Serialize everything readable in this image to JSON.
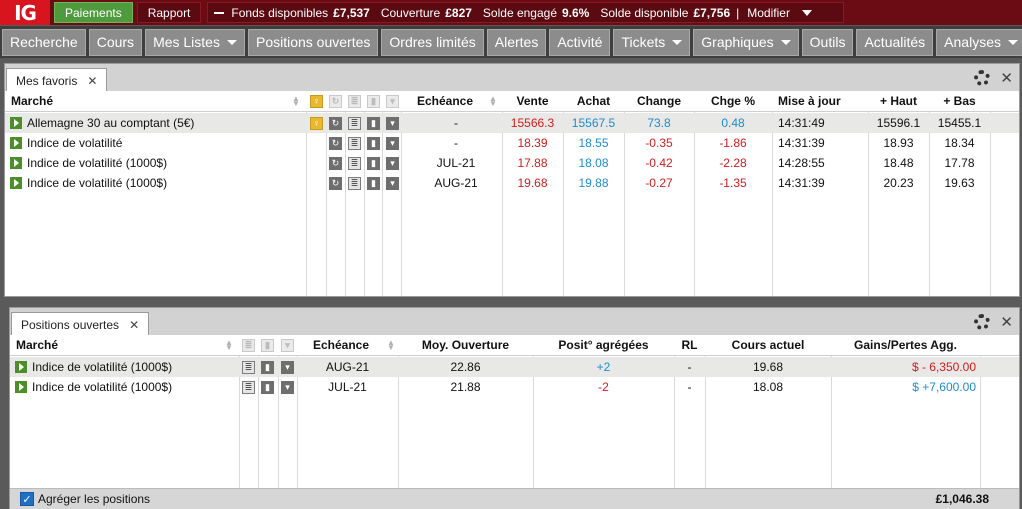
{
  "topbar": {
    "logo": "IG",
    "payments_label": "Paiements",
    "report_label": "Rapport",
    "funds_label": "Fonds disponibles",
    "funds_value": "£7,537",
    "margin_label": "Couverture",
    "margin_value": "£827",
    "used_label": "Solde engagé",
    "used_value": "9.6%",
    "available_label": "Solde disponible",
    "available_value": "£7,756",
    "modify_label": "Modifier"
  },
  "nav": {
    "items": [
      {
        "label": "Recherche",
        "dropdown": false
      },
      {
        "label": "Cours",
        "dropdown": false
      },
      {
        "label": "Mes Listes",
        "dropdown": true
      },
      {
        "label": "Positions ouvertes",
        "dropdown": false
      },
      {
        "label": "Ordres limités",
        "dropdown": false
      },
      {
        "label": "Alertes",
        "dropdown": false
      },
      {
        "label": "Activité",
        "dropdown": false
      },
      {
        "label": "Tickets",
        "dropdown": true
      },
      {
        "label": "Graphiques",
        "dropdown": true
      },
      {
        "label": "Outils",
        "dropdown": false
      },
      {
        "label": "Actualités",
        "dropdown": false
      },
      {
        "label": "Analyses",
        "dropdown": true
      }
    ]
  },
  "favorites": {
    "tab_label": "Mes favoris",
    "columns": {
      "market": "Marché",
      "expiry": "Echéance",
      "sell": "Vente",
      "buy": "Achat",
      "change": "Change",
      "change_pct": "Chge %",
      "updated": "Mise à jour",
      "high": "+ Haut",
      "low": "+ Bas"
    },
    "rows": [
      {
        "market": "Allemagne 30 au comptant (5€)",
        "expiry": "-",
        "sell": "15566.3",
        "buy": "15567.5",
        "change": "73.8",
        "change_pct": "0.48",
        "updated": "14:31:49",
        "high": "15596.1",
        "low": "15455.1",
        "trend": "up",
        "alert_active": true
      },
      {
        "market": "Indice de volatilité",
        "expiry": "-",
        "sell": "18.39",
        "buy": "18.55",
        "change": "-0.35",
        "change_pct": "-1.86",
        "updated": "14:31:39",
        "high": "18.93",
        "low": "18.34",
        "trend": "down",
        "alert_active": false
      },
      {
        "market": "Indice de volatilité (1000$)",
        "expiry": "JUL-21",
        "sell": "17.88",
        "buy": "18.08",
        "change": "-0.42",
        "change_pct": "-2.28",
        "updated": "14:28:55",
        "high": "18.48",
        "low": "17.78",
        "trend": "down",
        "alert_active": false
      },
      {
        "market": "Indice de volatilité (1000$)",
        "expiry": "AUG-21",
        "sell": "19.68",
        "buy": "19.88",
        "change": "-0.27",
        "change_pct": "-1.35",
        "updated": "14:31:39",
        "high": "20.23",
        "low": "19.63",
        "trend": "down",
        "alert_active": false
      }
    ]
  },
  "positions": {
    "tab_label": "Positions ouvertes",
    "columns": {
      "market": "Marché",
      "expiry": "Echéance",
      "open_avg": "Moy. Ouverture",
      "aggregated": "Posit° agrégées",
      "rl": "RL",
      "current": "Cours actuel",
      "pnl": "Gains/Pertes Agg."
    },
    "rows": [
      {
        "market": "Indice de volatilité (1000$)",
        "expiry": "AUG-21",
        "open_avg": "22.86",
        "aggregated": "+2",
        "rl": "-",
        "current": "19.68",
        "pnl": "$ - 6,350.00",
        "pnl_sign": "neg",
        "agg_sign": "pos"
      },
      {
        "market": "Indice de volatilité (1000$)",
        "expiry": "JUL-21",
        "open_avg": "21.88",
        "aggregated": "-2",
        "rl": "-",
        "current": "18.08",
        "pnl": "$ +7,600.00",
        "pnl_sign": "pos",
        "agg_sign": "neg"
      }
    ],
    "aggregate_label": "Agréger les positions",
    "aggregate_checked": true,
    "total": "£1,046.38"
  },
  "colors": {
    "positive": "#1e8ccf",
    "negative": "#d01d1d",
    "brand": "#d8141e"
  }
}
